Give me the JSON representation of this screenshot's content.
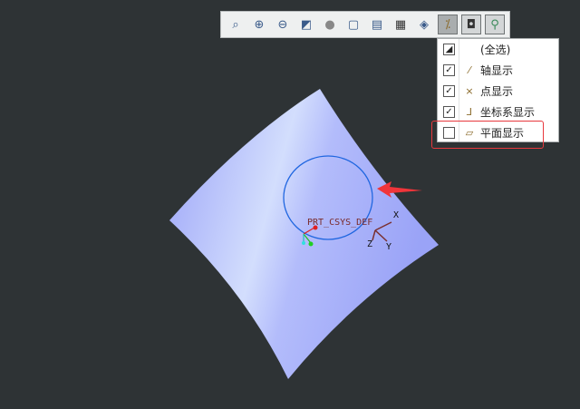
{
  "toolbar": {
    "buttons": [
      "zoom-fit",
      "zoom-in",
      "zoom-out",
      "repaint",
      "display-style",
      "saved-orientations",
      "view-manager",
      "snapshot",
      "perspective",
      "datum-display-filters",
      "annotation-display",
      "spin-center"
    ]
  },
  "menu": {
    "items": [
      {
        "label": "(全选)",
        "checked": "partial"
      },
      {
        "label": "轴显示",
        "checked": true
      },
      {
        "label": "点显示",
        "checked": true
      },
      {
        "label": "坐标系显示",
        "checked": true
      },
      {
        "label": "平面显示",
        "checked": false
      }
    ]
  },
  "viewport": {
    "csys_label": "PRT_CSYS_DEF",
    "axis_x": "X",
    "axis_y": "Y",
    "axis_z": "Z"
  },
  "colors": {
    "background": "#2e3335",
    "surface": "#a4acfa",
    "highlight": "#e8383d",
    "circle": "#1f66e0"
  }
}
